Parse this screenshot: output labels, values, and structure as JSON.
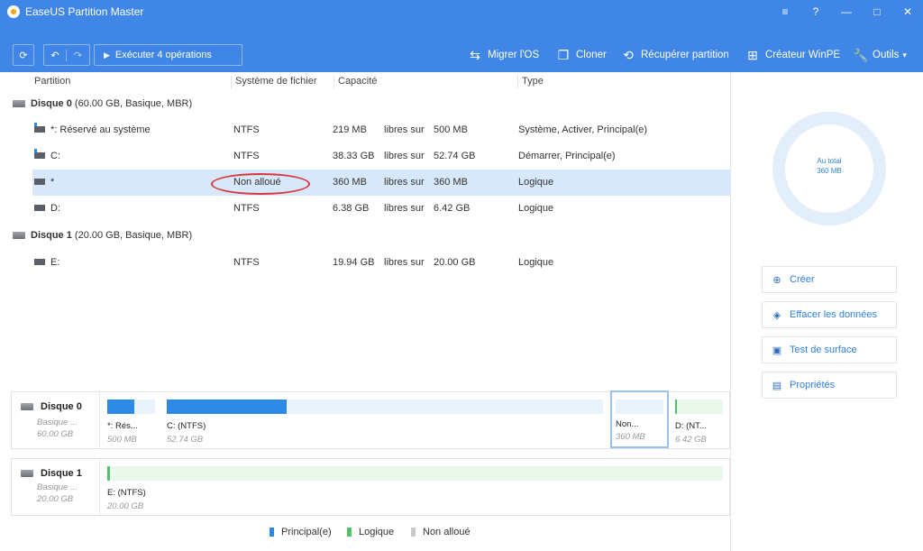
{
  "window": {
    "title": "EaseUS Partition Master"
  },
  "window_controls": [
    "≡",
    "?",
    "—",
    "□",
    "✕"
  ],
  "toolbar": {
    "refresh_label": "⟳",
    "undo_label": "↶",
    "redo_label": "↷",
    "execute_label": "Exécuter 4 opérations",
    "migrate_label": "Migrer l'OS",
    "clone_label": "Cloner",
    "recover_label": "Récupérer partition",
    "winpe_label": "Créateur WinPE",
    "tools_label": "Outils",
    "tools_arrow": "▾"
  },
  "table": {
    "headers": [
      "Partition",
      "Système de fichier",
      "Capacité",
      "Type"
    ],
    "disk0": {
      "name": "Disque 0",
      "info": "(60.00 GB, Basique, MBR)"
    },
    "disk1": {
      "name": "Disque 1",
      "info": "(20.00 GB, Basique, MBR)"
    },
    "rows": [
      {
        "partition": "*: Réservé au système",
        "fs": "NTFS",
        "free": "219 MB",
        "free_label": "libres sur",
        "total": "500 MB",
        "type": "Système, Activer, Principal(e)"
      },
      {
        "partition": "C:",
        "fs": "NTFS",
        "free": "38.33 GB",
        "free_label": "libres sur",
        "total": "52.74 GB",
        "type": "Démarrer, Principal(e)"
      },
      {
        "partition": "*",
        "fs": "Non alloué",
        "free": "360 MB",
        "free_label": "libres sur",
        "total": "360 MB",
        "type": "Logique"
      },
      {
        "partition": "D:",
        "fs": "NTFS",
        "free": "6.38 GB",
        "free_label": "libres sur",
        "total": "6.42 GB",
        "type": "Logique"
      },
      {
        "partition": "E:",
        "fs": "NTFS",
        "free": "19.94 GB",
        "free_label": "libres sur",
        "total": "20.00 GB",
        "type": "Logique"
      }
    ]
  },
  "side_panel": {
    "total_label": "Au total",
    "total_value": "360 MB",
    "actions": [
      "Créer",
      "Effacer les données",
      "Test de surface",
      "Propriétés"
    ]
  },
  "diskmap": {
    "disk0": {
      "name": "Disque 0",
      "kind": "Basique ...",
      "size": "60.00 GB",
      "segments": [
        {
          "label": "*: Rés...",
          "size": "500 MB",
          "used_fraction": 0.56
        },
        {
          "label": "C:  (NTFS)",
          "size": "52.74 GB",
          "used_fraction": 0.27
        },
        {
          "label": "Non...",
          "size": "360 MB"
        },
        {
          "label": "D:  (NT...",
          "size": "6.42 GB",
          "used_fraction": 0.01
        }
      ]
    },
    "disk1": {
      "name": "Disque 1",
      "kind": "Basique ...",
      "size": "20.00 GB",
      "segments": [
        {
          "label": "E:  (NTFS)",
          "size": "20.00 GB",
          "used_fraction": 0.01
        }
      ]
    }
  },
  "legend": {
    "primary": "Principal(e)",
    "logical": "Logique",
    "unallocated": "Non alloué"
  },
  "colors": {
    "accent": "#3f86e6",
    "primary": "#2e88e6",
    "logical": "#4cc46a",
    "unallocated": "#c9c9c9",
    "selected": "#d8e8fb",
    "highlight_oval": "#d9363e"
  }
}
